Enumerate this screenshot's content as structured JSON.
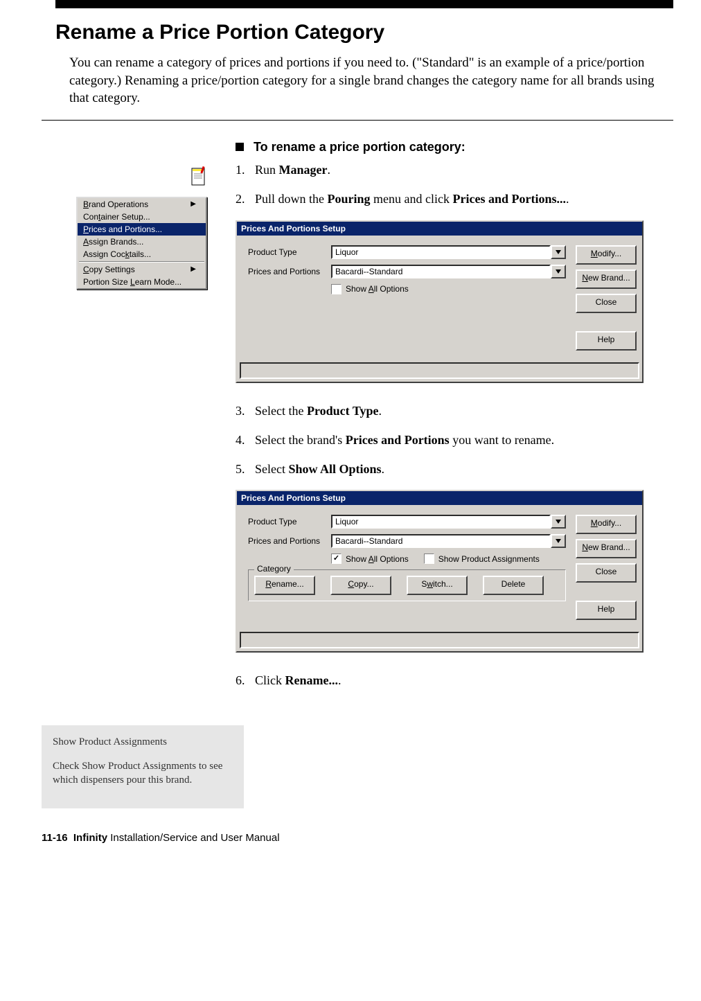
{
  "heading": "Rename a Price Portion Category",
  "intro": "You can rename a category of prices and portions if you need to. (\"Standard\" is an example of a price/portion category.) Renaming a price/portion category for a single brand changes the category name for all brands using that category.",
  "context_menu": {
    "items": [
      {
        "label_pre": "",
        "u": "B",
        "label_post": "rand Operations",
        "arrow": true,
        "selected": false
      },
      {
        "label_pre": "Con",
        "u": "t",
        "label_post": "ainer Setup...",
        "arrow": false,
        "selected": false
      },
      {
        "label_pre": "",
        "u": "P",
        "label_post": "rices and Portions...",
        "arrow": false,
        "selected": true
      },
      {
        "label_pre": "",
        "u": "A",
        "label_post": "ssign Brands...",
        "arrow": false,
        "selected": false
      },
      {
        "label_pre": "Assign Coc",
        "u": "k",
        "label_post": "tails...",
        "arrow": false,
        "selected": false
      }
    ],
    "items2": [
      {
        "label_pre": "",
        "u": "C",
        "label_post": "opy Settings",
        "arrow": true,
        "selected": false
      },
      {
        "label_pre": "Portion Size ",
        "u": "L",
        "label_post": "earn Mode...",
        "arrow": false,
        "selected": false
      }
    ]
  },
  "procedure_title": "To rename a price portion category:",
  "steps": {
    "s1_pre": "Run ",
    "s1_b": "Manager",
    "s1_post": ".",
    "s2_pre": "Pull down the ",
    "s2_b1": "Pouring",
    "s2_mid": " menu and click ",
    "s2_b2": "Prices and Portions...",
    "s2_post": ".",
    "s3_pre": "Select the ",
    "s3_b": "Product Type",
    "s3_post": ".",
    "s4_pre": "Select the brand's ",
    "s4_b": "Prices and Portions",
    "s4_post": " you want to rename.",
    "s5_pre": "Select ",
    "s5_b": "Show All Options",
    "s5_post": ".",
    "s6_pre": "Click ",
    "s6_b": "Rename...",
    "s6_post": "."
  },
  "dialog1": {
    "title": "Prices And Portions Setup",
    "product_type_label": "Product Type",
    "product_type_value": "Liquor",
    "prices_label": "Prices and Portions",
    "prices_value": "Bacardi--Standard",
    "show_all_pre": "Show ",
    "show_all_u": "A",
    "show_all_post": "ll Options",
    "btn_modify_u": "M",
    "btn_modify_post": "odify...",
    "btn_new_u": "N",
    "btn_new_post": "ew Brand...",
    "btn_close": "Close",
    "btn_help": "Help"
  },
  "dialog2": {
    "title": "Prices And Portions Setup",
    "product_type_label": "Product Type",
    "product_type_value": "Liquor",
    "prices_label": "Prices and Portions",
    "prices_value": "Bacardi--Standard",
    "show_all_pre": "Show ",
    "show_all_u": "A",
    "show_all_post": "ll Options",
    "show_prod": "Show Product Assignments",
    "category_legend": "Category",
    "btn_rename_u": "R",
    "btn_rename_post": "ename...",
    "btn_copy_u": "C",
    "btn_copy_post": "opy...",
    "btn_switch_pre": "S",
    "btn_switch_u": "w",
    "btn_switch_post": "itch...",
    "btn_delete": "Delete",
    "btn_modify_u": "M",
    "btn_modify_post": "odify...",
    "btn_new_u": "N",
    "btn_new_post": "ew Brand...",
    "btn_close": "Close",
    "btn_help": "Help"
  },
  "tip": {
    "title": "Show Product Assignments",
    "body": "Check Show Product Assignments to see which dispensers pour this brand."
  },
  "footer_page": "11-16",
  "footer_product": "Infinity",
  "footer_rest": " Installation/Service and User Manual"
}
